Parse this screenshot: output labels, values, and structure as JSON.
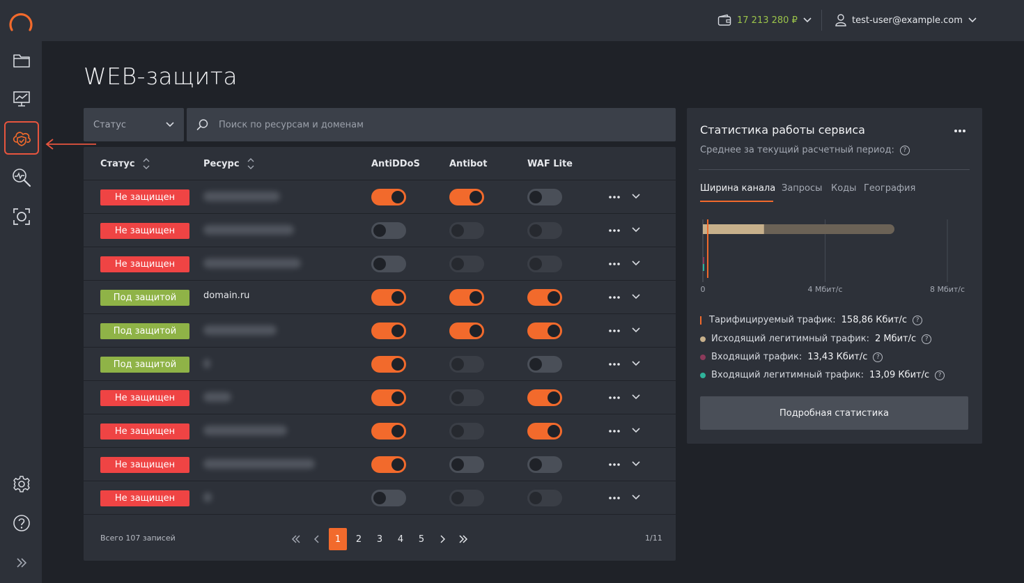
{
  "header": {
    "balance": "17 213 280 ₽",
    "user_email": "test-user@example.com"
  },
  "sidebar": {
    "items": [
      {
        "icon": "folder-icon"
      },
      {
        "icon": "chart-monitor-icon"
      },
      {
        "icon": "shield-cloud-icon",
        "active": true
      },
      {
        "icon": "search-pulse-icon"
      },
      {
        "icon": "scan-icon"
      }
    ],
    "bottom": [
      {
        "icon": "gear-icon"
      },
      {
        "icon": "help-icon"
      },
      {
        "icon": "expand-icon"
      }
    ]
  },
  "page": {
    "title": "WEB-защита"
  },
  "filters": {
    "status_label": "Статус",
    "search_placeholder": "Поиск по ресурсам и доменам"
  },
  "table": {
    "headers": {
      "status": "Статус",
      "resource": "Ресурс",
      "antiddos": "AntiDDoS",
      "antibot": "Antibot",
      "waf": "WAF Lite"
    },
    "rows": [
      {
        "status": "Не защищен",
        "state": "bad",
        "resource": "",
        "antiddos": "on",
        "antibot": "on",
        "waf": "off"
      },
      {
        "status": "Не защищен",
        "state": "bad",
        "resource": "",
        "antiddos": "off",
        "antibot": "dis",
        "waf": "dis"
      },
      {
        "status": "Не защищен",
        "state": "bad",
        "resource": "",
        "antiddos": "off",
        "antibot": "dis",
        "waf": "dis"
      },
      {
        "status": "Под защитой",
        "state": "good",
        "resource": "domain.ru",
        "antiddos": "on",
        "antibot": "on",
        "waf": "on"
      },
      {
        "status": "Под защитой",
        "state": "good",
        "resource": "",
        "antiddos": "on",
        "antibot": "on",
        "waf": "on"
      },
      {
        "status": "Под защитой",
        "state": "good",
        "resource": "",
        "antiddos": "on",
        "antibot": "dis",
        "waf": "off"
      },
      {
        "status": "Не защищен",
        "state": "bad",
        "resource": "",
        "antiddos": "on",
        "antibot": "dis",
        "waf": "on"
      },
      {
        "status": "Не защищен",
        "state": "bad",
        "resource": "",
        "antiddos": "on",
        "antibot": "dis",
        "waf": "on"
      },
      {
        "status": "Не защищен",
        "state": "bad",
        "resource": "",
        "antiddos": "on",
        "antibot": "off",
        "waf": "off"
      },
      {
        "status": "Не защищен",
        "state": "bad",
        "resource": "",
        "antiddos": "off",
        "antibot": "dis",
        "waf": "dis"
      }
    ],
    "footer": {
      "total": "Всего 107 записей",
      "pages": [
        "1",
        "2",
        "3",
        "4",
        "5"
      ],
      "current_page": "1",
      "page_info": "1/11"
    }
  },
  "stats": {
    "title": "Статистика работы сервиса",
    "subtitle": "Среднее за текущий расчетный период:",
    "tabs": [
      "Ширина канала",
      "Запросы",
      "Коды",
      "География"
    ],
    "active_tab": "Ширина канала",
    "axis_ticks": [
      "0",
      "4 Мбит/с",
      "8 Мбит/с"
    ],
    "legend": [
      {
        "label": "Тарифицируемый трафик:",
        "value": "158,86 Кбит/с",
        "color": "#f26a2c",
        "marker": "bar"
      },
      {
        "label": "Исходящий легитимный трафик:",
        "value": "2 Мбит/с",
        "color": "#c7b08b",
        "marker": "dot"
      },
      {
        "label": "Входящий трафик:",
        "value": "13,43 Кбит/с",
        "color": "#8b3a5a",
        "marker": "dot"
      },
      {
        "label": "Входящий легитимный трафик:",
        "value": "13,09 Кбит/с",
        "color": "#2fb39a",
        "marker": "dot"
      }
    ],
    "details_button": "Подробная статистика"
  },
  "chart_data": {
    "type": "bar",
    "orientation": "horizontal",
    "xlim": [
      0,
      8
    ],
    "x_unit": "Мбит/с",
    "x_ticks": [
      "0",
      "4 Мбит/с",
      "8 Мбит/с"
    ],
    "series": [
      {
        "name": "Тарифицируемый трафик",
        "value": 0.159,
        "color": "#f26a2c"
      },
      {
        "name": "Исходящий легитимный трафик",
        "value": 2,
        "color": "#c7b08b"
      },
      {
        "name": "Входящий трафик",
        "value": 0.013,
        "color": "#8b3a5a"
      },
      {
        "name": "Входящий легитимный трафик",
        "value": 0.013,
        "color": "#2fb39a"
      }
    ]
  }
}
